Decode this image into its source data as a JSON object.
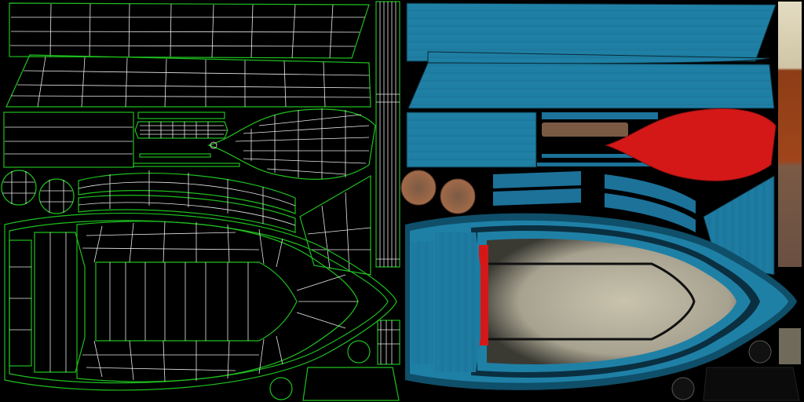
{
  "image": {
    "description_role": "uv-layout-and-texture-atlas",
    "left_panel": "wireframe-uv-layout",
    "right_panel": "painted-texture-atlas"
  },
  "colors": {
    "background": "#000000",
    "uv_outline": "#1fbf1f",
    "uv_mesh": "#e8e8e8",
    "wood_blue": "#1f7fa3",
    "wood_blue_dark": "#0f5570",
    "hull_interior": "#c7c2ad",
    "red_paint": "#d01818",
    "rust": "#8a4b2a",
    "bone": "#d9d2b6"
  }
}
